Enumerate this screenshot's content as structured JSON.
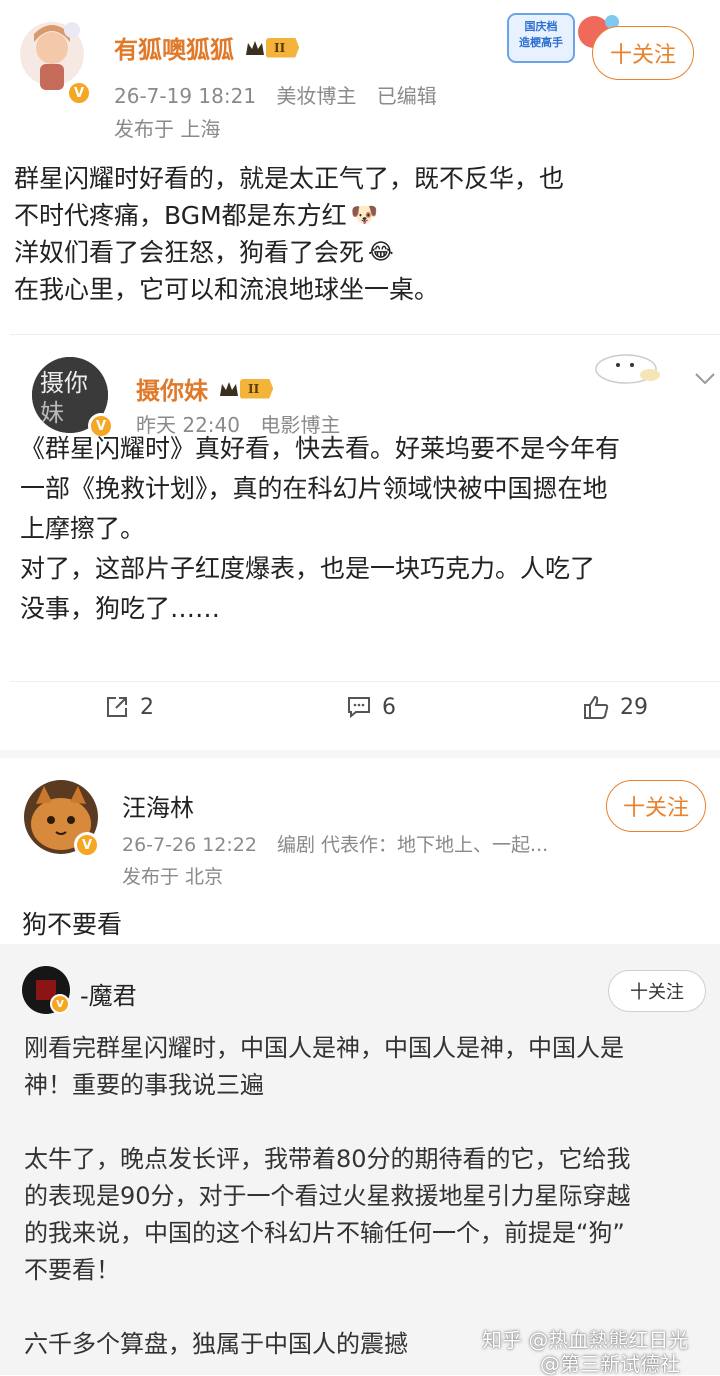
{
  "post1": {
    "username": "有狐噢狐狐",
    "level": "II",
    "timestamp": "26-7-19 18:21",
    "role": "美妆博主",
    "edited": "已编辑",
    "location": "发布于 上海",
    "follow_label": "十关注",
    "sticker_text": "国庆档\n造梗高手",
    "lines": [
      "群星闪耀时好看的，就是太正气了，既不反华，也",
      "不时代疼痛，BGM都是东方红",
      "洋奴们看了会狂怒，狗看了会死",
      "在我心里，它可以和流浪地球坐一桌。"
    ]
  },
  "repost": {
    "username": "摄你妹",
    "level": "II",
    "timestamp": "昨天 22:40",
    "role": "电影博主",
    "lines": [
      "《群星闪耀时》真好看，快去看。好莱坞要不是今年有",
      "一部《挽救计划》，真的在科幻片领域快被中国摁在地",
      "上摩擦了。",
      "对了，这部片子红度爆表，也是一块巧克力。人吃了",
      "没事，狗吃了……"
    ],
    "actions": {
      "share": "2",
      "comment": "6",
      "like": "29"
    }
  },
  "post2": {
    "username": "汪海林",
    "timestamp": "26-7-26 12:22",
    "role": "编剧 代表作：地下地上、一起...",
    "location": "发布于 北京",
    "follow_label": "十关注",
    "text": "狗不要看"
  },
  "post3": {
    "username": "-魔君",
    "follow_label": "十关注",
    "paragraphs": [
      [
        "刚看完群星闪耀时，中国人是神，中国人是神，中国人是",
        "神！重要的事我说三遍"
      ],
      [
        "太牛了，晚点发长评，我带着80分的期待看的它，它给我",
        "的表现是90分，对于一个看过火星救援地星引力星际穿越",
        "的我来说，中国的这个科幻片不输任何一个，前提是“狗”",
        "不要看！"
      ],
      [
        "六千多个算盘，独属于中国人的震撼"
      ]
    ]
  },
  "watermark": {
    "zhihu": "知乎 @热血熱熊红日光",
    "weibo": "@第三新试德社"
  },
  "colors": {
    "accent": "#e8822e",
    "name": "#e07a2a",
    "meta": "#8a8a8a",
    "repost_bg": "#ffffff",
    "post3_bg": "#f4f4f4"
  }
}
